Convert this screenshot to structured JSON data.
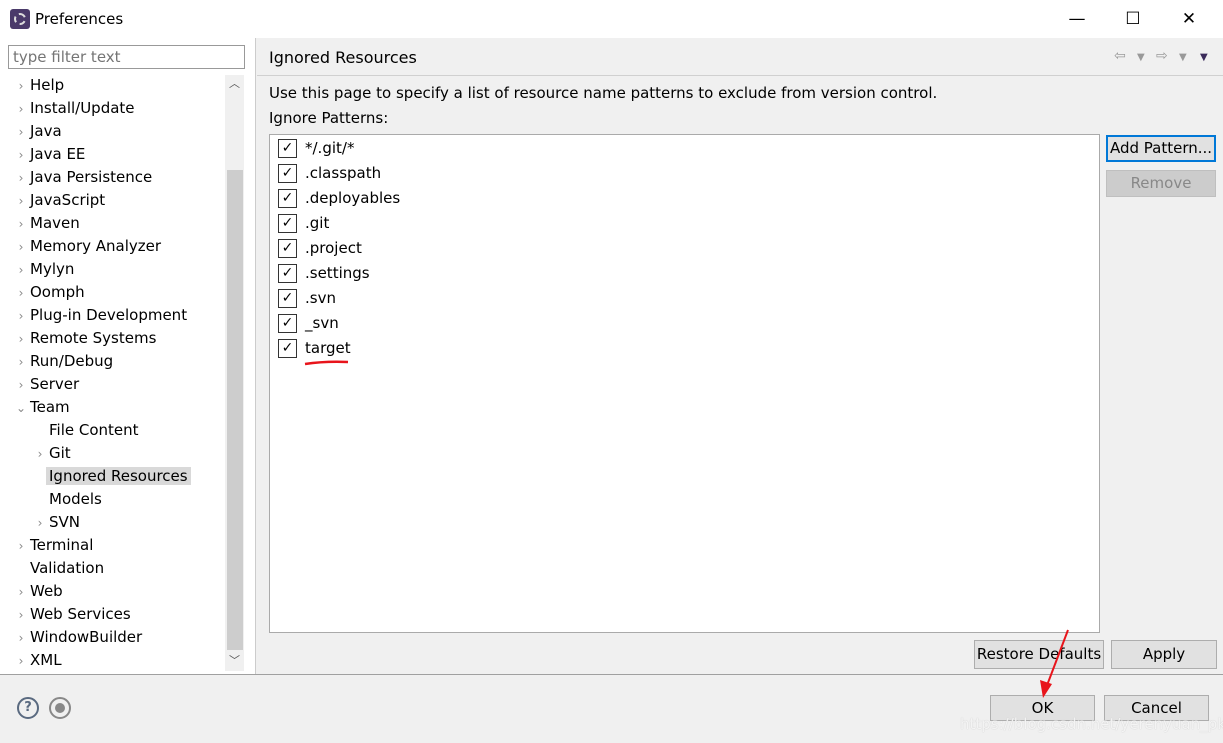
{
  "window": {
    "title": "Preferences",
    "minimize": "—",
    "maximize": "☐",
    "close": "✕"
  },
  "sidebar": {
    "filter_placeholder": "type filter text",
    "items": [
      {
        "label": "Help",
        "expandable": true
      },
      {
        "label": "Install/Update",
        "expandable": true
      },
      {
        "label": "Java",
        "expandable": true
      },
      {
        "label": "Java EE",
        "expandable": true
      },
      {
        "label": "Java Persistence",
        "expandable": true
      },
      {
        "label": "JavaScript",
        "expandable": true
      },
      {
        "label": "Maven",
        "expandable": true
      },
      {
        "label": "Memory Analyzer",
        "expandable": true
      },
      {
        "label": "Mylyn",
        "expandable": true
      },
      {
        "label": "Oomph",
        "expandable": true
      },
      {
        "label": "Plug-in Development",
        "expandable": true
      },
      {
        "label": "Remote Systems",
        "expandable": true
      },
      {
        "label": "Run/Debug",
        "expandable": true
      },
      {
        "label": "Server",
        "expandable": true
      },
      {
        "label": "Team",
        "expanded": true,
        "children": [
          {
            "label": "File Content"
          },
          {
            "label": "Git",
            "expandable": true
          },
          {
            "label": "Ignored Resources",
            "selected": true
          },
          {
            "label": "Models"
          },
          {
            "label": "SVN",
            "expandable": true
          }
        ]
      },
      {
        "label": "Terminal",
        "expandable": true
      },
      {
        "label": "Validation"
      },
      {
        "label": "Web",
        "expandable": true
      },
      {
        "label": "Web Services",
        "expandable": true
      },
      {
        "label": "WindowBuilder",
        "expandable": true
      },
      {
        "label": "XML",
        "expandable": true
      }
    ]
  },
  "page": {
    "title": "Ignored Resources",
    "description": "Use this page to specify a list of resource name patterns to exclude from version control.",
    "patterns_label": "Ignore Patterns:",
    "patterns": [
      {
        "name": "*/.git/*",
        "checked": true
      },
      {
        "name": ".classpath",
        "checked": true
      },
      {
        "name": ".deployables",
        "checked": true
      },
      {
        "name": ".git",
        "checked": true
      },
      {
        "name": ".project",
        "checked": true
      },
      {
        "name": ".settings",
        "checked": true
      },
      {
        "name": ".svn",
        "checked": true
      },
      {
        "name": "_svn",
        "checked": true
      },
      {
        "name": "target",
        "checked": true,
        "annotated": true
      }
    ],
    "add_pattern": "Add Pattern...",
    "remove": "Remove",
    "restore_defaults": "Restore Defaults",
    "apply": "Apply"
  },
  "footer": {
    "ok": "OK",
    "cancel": "Cancel",
    "help_icon": "?"
  },
  "annotation_color": "#e8141b",
  "watermark": "https://blog.csdn.net/yerenyuan_pku"
}
